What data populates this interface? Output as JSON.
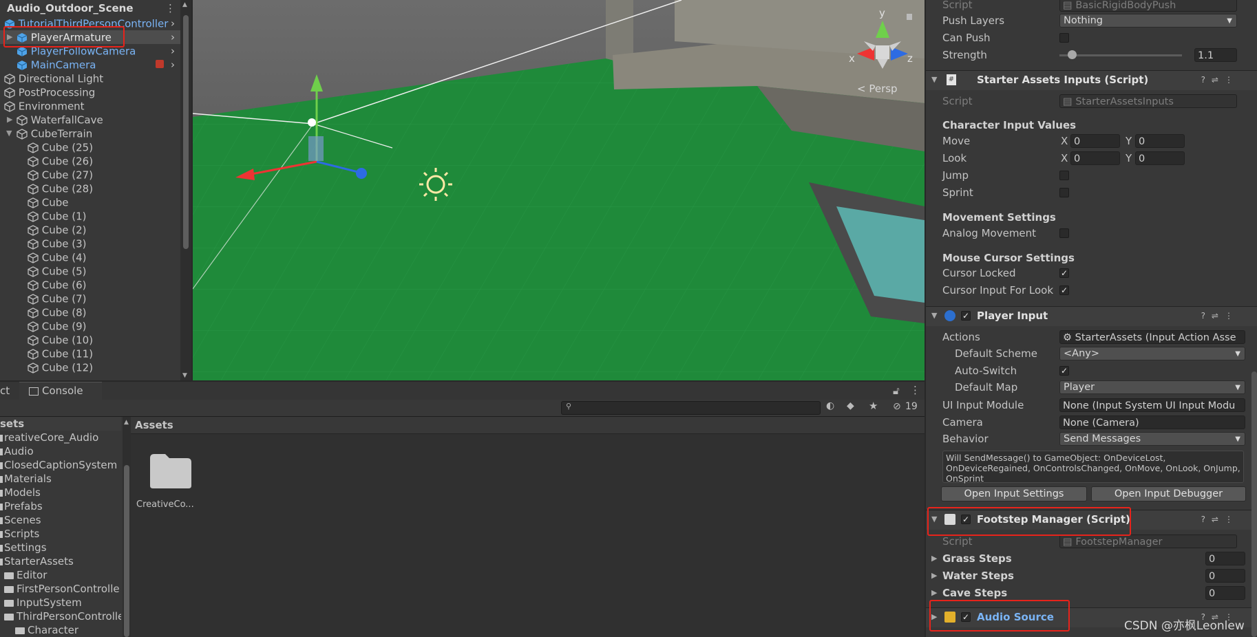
{
  "hierarchy": {
    "scene_name": "Audio_Outdoor_Scene",
    "items": [
      {
        "label": "TutorialThirdPersonController",
        "color": "blue"
      },
      {
        "label": "PlayerArmature",
        "color": "normal"
      },
      {
        "label": "PlayerFollowCamera",
        "color": "blue"
      },
      {
        "label": "MainCamera",
        "color": "blue"
      },
      {
        "label": "Directional Light"
      },
      {
        "label": "PostProcessing"
      },
      {
        "label": "Environment"
      },
      {
        "label": "WaterfallCave"
      },
      {
        "label": "CubeTerrain"
      },
      {
        "label": "Cube (25)"
      },
      {
        "label": "Cube (26)"
      },
      {
        "label": "Cube (27)"
      },
      {
        "label": "Cube (28)"
      },
      {
        "label": "Cube"
      },
      {
        "label": "Cube (1)"
      },
      {
        "label": "Cube (2)"
      },
      {
        "label": "Cube (3)"
      },
      {
        "label": "Cube (4)"
      },
      {
        "label": "Cube (5)"
      },
      {
        "label": "Cube (6)"
      },
      {
        "label": "Cube (7)"
      },
      {
        "label": "Cube (8)"
      },
      {
        "label": "Cube (9)"
      },
      {
        "label": "Cube (10)"
      },
      {
        "label": "Cube (11)"
      },
      {
        "label": "Cube (12)"
      }
    ]
  },
  "sceneview": {
    "axis_y": "y",
    "axis_x": "x",
    "axis_z": "z",
    "projection": "< Persp"
  },
  "bottom": {
    "tab_project_fragment": "ct",
    "tab_console": "Console",
    "hidden_count": "19",
    "tree_header": "sets",
    "tree": [
      "reativeCore_Audio",
      "Audio",
      "ClosedCaptionSystem",
      "Materials",
      "Models",
      "Prefabs",
      "Scenes",
      "Scripts",
      "Settings",
      "StarterAssets",
      "Editor",
      "FirstPersonControlle",
      "InputSystem",
      "ThirdPersonControlle",
      "Character"
    ],
    "assets_title": "Assets",
    "folder_label": "CreativeCo..."
  },
  "inspector": {
    "top": {
      "script_label": "Script",
      "script_value": "BasicRigidBodyPush",
      "push_layers_label": "Push Layers",
      "push_layers_value": "Nothing",
      "can_push_label": "Can Push",
      "strength_label": "Strength",
      "strength_value": "1.1",
      "strength_fraction": 0.1
    },
    "starter_inputs": {
      "title": "Starter Assets Inputs (Script)",
      "script_label": "Script",
      "script_value": "StarterAssetsInputs",
      "section_character": "Character Input Values",
      "move_label": "Move",
      "move_x": "0",
      "move_y": "0",
      "look_label": "Look",
      "look_x": "0",
      "look_y": "0",
      "x_label": "X",
      "y_label": "Y",
      "jump_label": "Jump",
      "sprint_label": "Sprint",
      "section_movement": "Movement Settings",
      "analog_label": "Analog Movement",
      "section_cursor": "Mouse Cursor Settings",
      "cursor_locked_label": "Cursor Locked",
      "cursor_look_label": "Cursor Input For Look"
    },
    "player_input": {
      "title": "Player Input",
      "actions_label": "Actions",
      "actions_value": "StarterAssets (Input Action Asse",
      "default_scheme_label": "Default Scheme",
      "default_scheme_value": "<Any>",
      "auto_switch_label": "Auto-Switch",
      "default_map_label": "Default Map",
      "default_map_value": "Player",
      "ui_module_label": "UI Input Module",
      "ui_module_value": "None (Input System UI Input Modu",
      "camera_label": "Camera",
      "camera_value": "None (Camera)",
      "behavior_label": "Behavior",
      "behavior_value": "Send Messages",
      "help_text": "Will SendMessage() to GameObject: OnDeviceLost, OnDeviceRegained, OnControlsChanged, OnMove, OnLook, OnJump, OnSprint",
      "open_settings": "Open Input Settings",
      "open_debugger": "Open Input Debugger"
    },
    "footstep": {
      "title": "Footstep Manager (Script)",
      "script_label": "Script",
      "script_value": "FootstepManager",
      "grass_label": "Grass Steps",
      "grass_value": "0",
      "water_label": "Water Steps",
      "water_value": "0",
      "cave_label": "Cave Steps",
      "cave_value": "0"
    },
    "audio_source": {
      "title": "Audio Source"
    }
  },
  "watermark": "CSDN @亦枫Leonlew",
  "colors": {
    "highlight_box": "#e8231b",
    "scene_grass": "#1f8a3a",
    "blue_prefab": "#7ab4f5"
  }
}
